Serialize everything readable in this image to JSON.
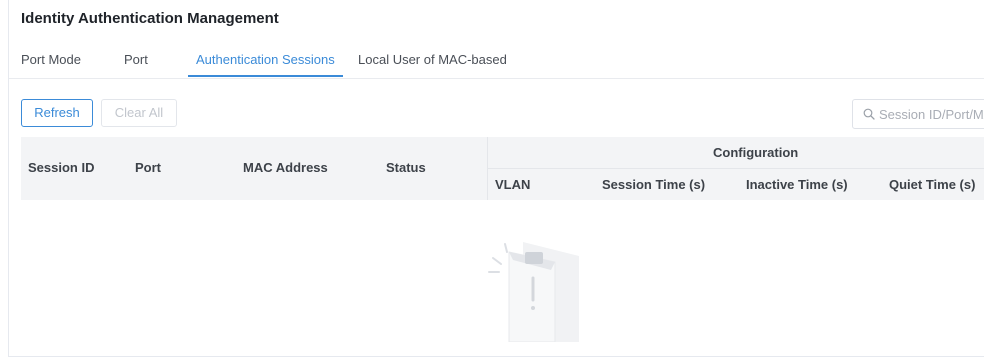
{
  "page": {
    "title": "Identity Authentication Management"
  },
  "tabs": [
    {
      "label": "Port Mode",
      "active": false
    },
    {
      "label": "Port",
      "active": false
    },
    {
      "label": "Authentication Sessions",
      "active": true
    },
    {
      "label": "Local User of MAC-based",
      "active": false
    }
  ],
  "toolbar": {
    "refresh_label": "Refresh",
    "clear_all_label": "Clear All"
  },
  "search": {
    "placeholder": "Session ID/Port/MAC"
  },
  "table": {
    "columns": {
      "session_id": "Session ID",
      "port": "Port",
      "mac_address": "MAC Address",
      "status": "Status",
      "configuration": "Configuration",
      "vlan": "VLAN",
      "session_time": "Session Time (s)",
      "inactive_time": "Inactive Time (s)",
      "quiet_time": "Quiet Time (s)"
    },
    "rows": []
  },
  "colors": {
    "accent": "#3b8bd8",
    "header_bg": "#f3f4f6",
    "disabled_text": "#c2c6cd"
  },
  "icons": {
    "search": "search-icon",
    "empty": "empty-data-illustration"
  }
}
